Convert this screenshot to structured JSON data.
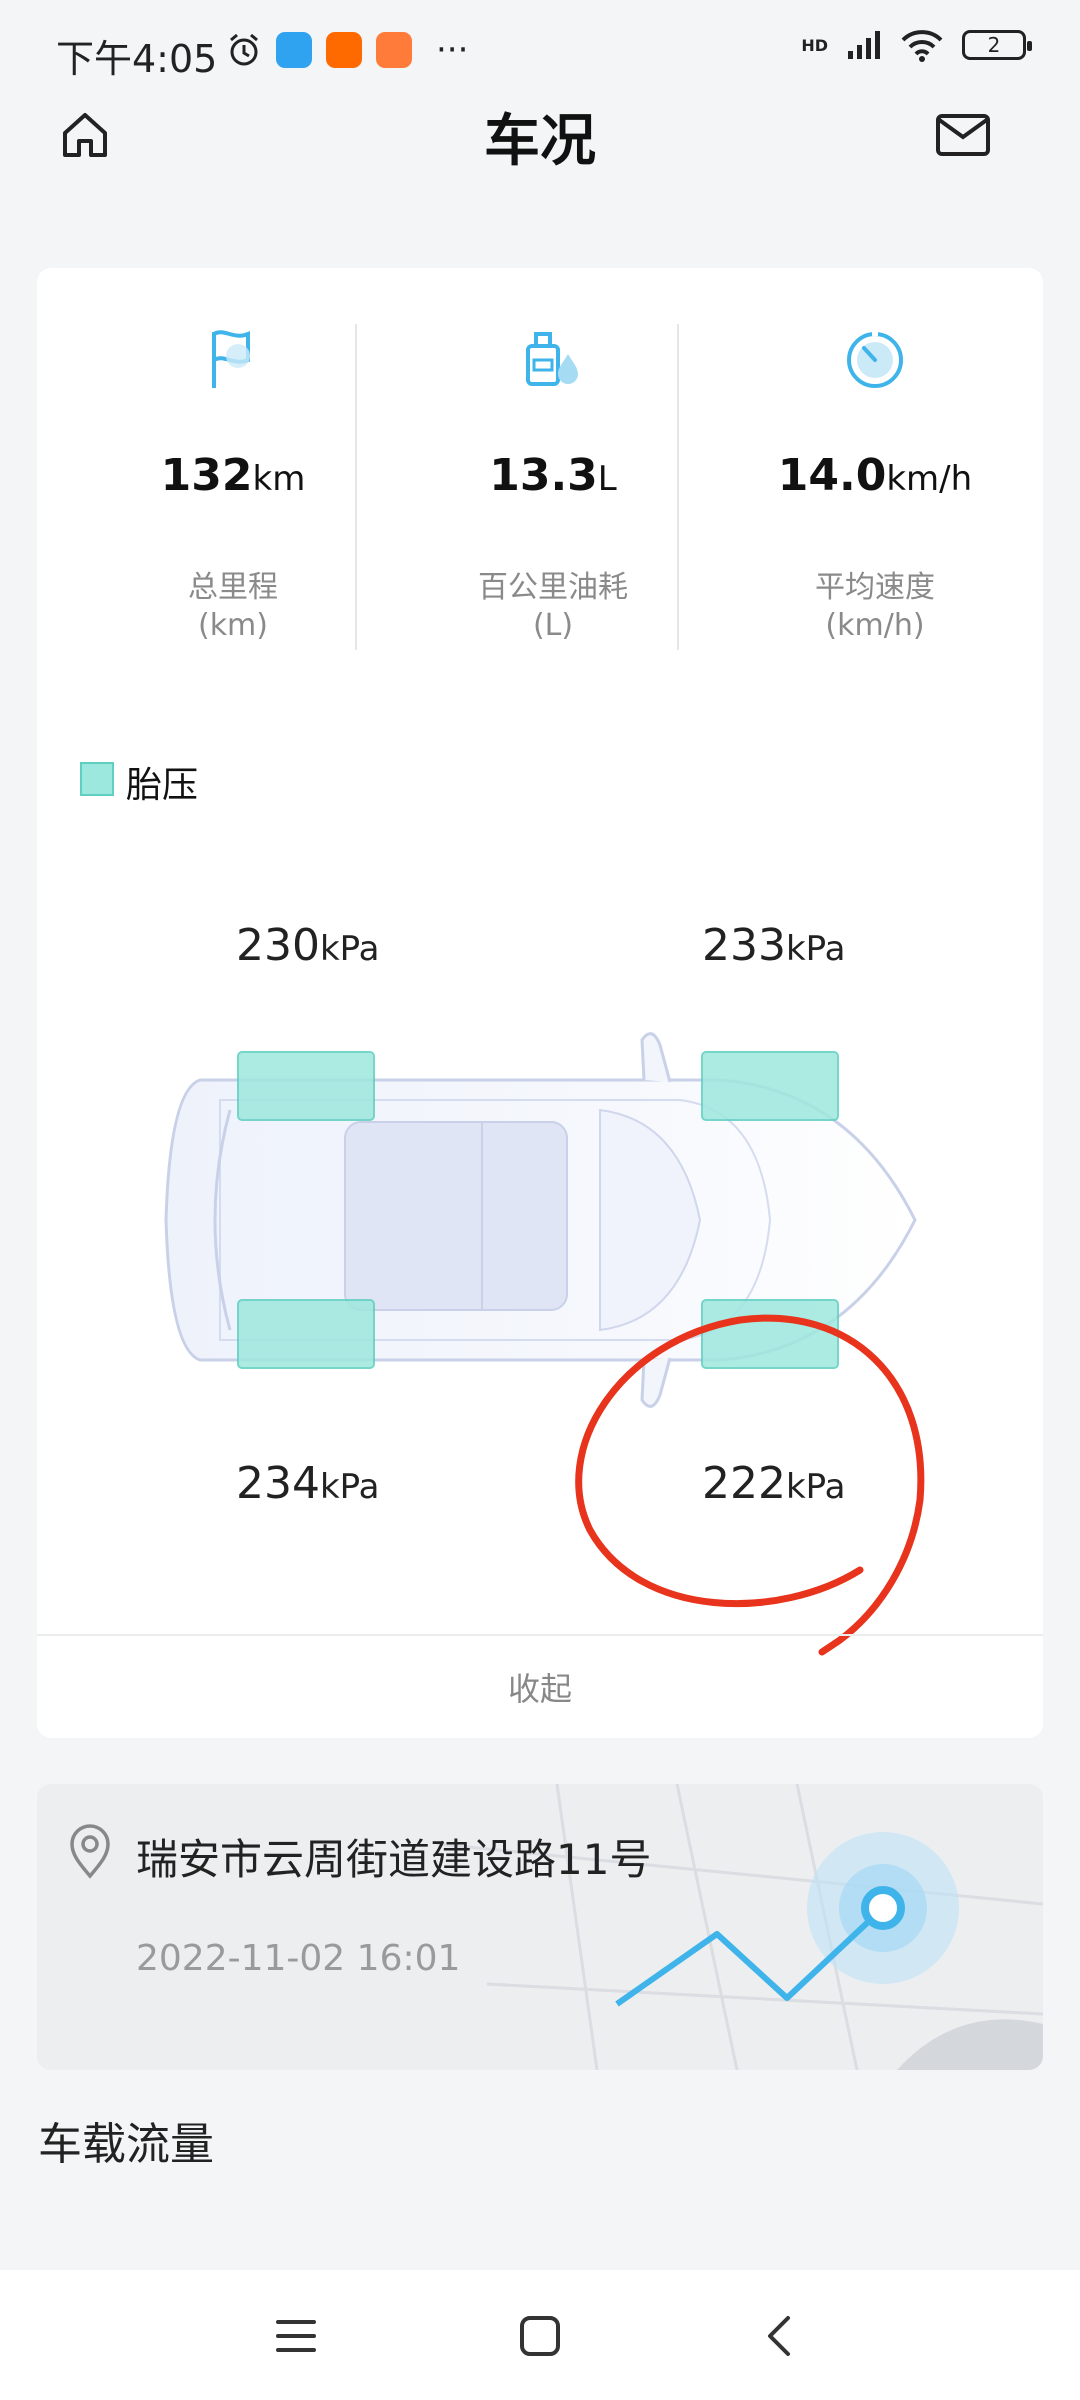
{
  "status_bar": {
    "time": "下午4:05",
    "more": "···",
    "network": "HD",
    "battery": "2"
  },
  "header": {
    "title": "车况"
  },
  "stats": [
    {
      "value": "132",
      "unit": "km",
      "label": "总里程",
      "sublabel": "(km)",
      "icon": "flag-icon"
    },
    {
      "value": "13.3",
      "unit": "L",
      "label": "百公里油耗",
      "sublabel": "(L)",
      "icon": "fuel-icon"
    },
    {
      "value": "14.0",
      "unit": "km/h",
      "label": "平均速度",
      "sublabel": "(km/h)",
      "icon": "speedometer-icon"
    }
  ],
  "tire_pressure": {
    "legend": "胎压",
    "front_left": {
      "value": "230",
      "unit": "kPa"
    },
    "front_right": {
      "value": "233",
      "unit": "kPa"
    },
    "rear_left": {
      "value": "234",
      "unit": "kPa"
    },
    "rear_right": {
      "value": "222",
      "unit": "kPa"
    },
    "collapse_label": "收起"
  },
  "location": {
    "address": "瑞安市云周街道建设路11号",
    "time": "2022-11-02 16:01"
  },
  "section": {
    "title": "车载流量"
  },
  "colors": {
    "accent": "#3fb4ea",
    "tire_fill": "#9de8de",
    "annotation": "#e8341c"
  }
}
